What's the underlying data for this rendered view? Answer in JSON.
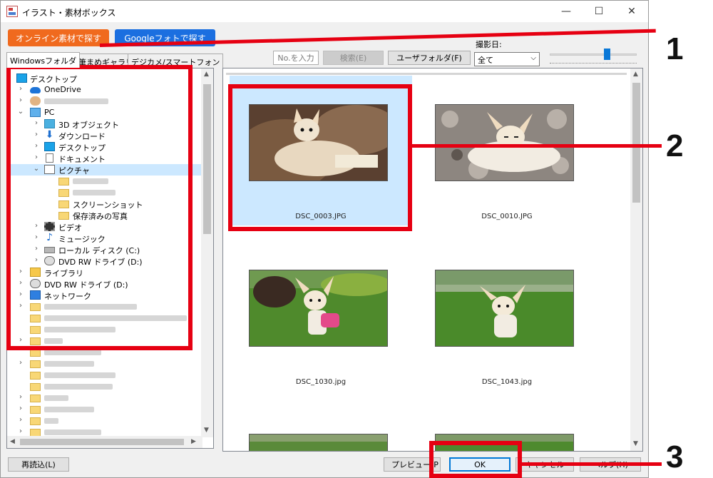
{
  "window": {
    "title": "イラスト・素材ボックス",
    "controls": {
      "minimize": "—",
      "maximize": "☐",
      "close": "✕"
    }
  },
  "toolbar": {
    "online_button": "オンライン素材で探す",
    "google_button": "Googleフォトで探す",
    "no_placeholder": "No.を入力",
    "search_button": "検索(E)",
    "user_folder_button": "ユーザフォルダ(F)",
    "date_label": "撮影日:",
    "date_value": "全て"
  },
  "tabs": [
    "Windowsフォルダ",
    "筆まめギャラリ",
    "デジカメ/スマートフォン"
  ],
  "tree": {
    "items": [
      {
        "label": "デスクトップ",
        "icon": "monitor-icon"
      },
      {
        "label": "OneDrive",
        "icon": "cloud-icon"
      },
      {
        "label": "",
        "icon": "user-icon"
      },
      {
        "label": "PC",
        "icon": "pc-icon"
      },
      {
        "label": "3D オブジェクト",
        "icon": "cube-icon"
      },
      {
        "label": "ダウンロード",
        "icon": "download-icon"
      },
      {
        "label": "デスクトップ",
        "icon": "monitor-icon"
      },
      {
        "label": "ドキュメント",
        "icon": "document-icon"
      },
      {
        "label": "ピクチャ",
        "icon": "pictures-icon"
      },
      {
        "label": "スクリーンショット",
        "icon": "folder-icon"
      },
      {
        "label": "保存済みの写真",
        "icon": "folder-icon"
      },
      {
        "label": "ビデオ",
        "icon": "video-icon"
      },
      {
        "label": "ミュージック",
        "icon": "music-icon"
      },
      {
        "label": "ローカル ディスク (C:)",
        "icon": "disk-icon"
      },
      {
        "label": "DVD RW ドライブ (D:)",
        "icon": "dvd-icon"
      },
      {
        "label": "ライブラリ",
        "icon": "library-icon"
      },
      {
        "label": "DVD RW ドライブ (D:)",
        "icon": "dvd-icon"
      },
      {
        "label": "ネットワーク",
        "icon": "network-icon"
      }
    ]
  },
  "gallery": {
    "items": [
      {
        "filename": "DSC_0003.JPG",
        "selected": true
      },
      {
        "filename": "DSC_0010.JPG",
        "selected": false
      },
      {
        "filename": "DSC_1030.jpg",
        "selected": false
      },
      {
        "filename": "DSC_1043.jpg",
        "selected": false
      }
    ]
  },
  "footer": {
    "reload_button": "再読込(L)",
    "preview_button": "プレビュー(P",
    "ok_button": "OK",
    "cancel_button": "キャンセル",
    "help_button": "ヘルプ(H)"
  },
  "annotations": {
    "n1": "1",
    "n2": "2",
    "n3": "3"
  },
  "colors": {
    "accent_red": "#e60012",
    "orange": "#f06a1e",
    "blue": "#1b6fe0",
    "selection": "#cce8ff"
  }
}
